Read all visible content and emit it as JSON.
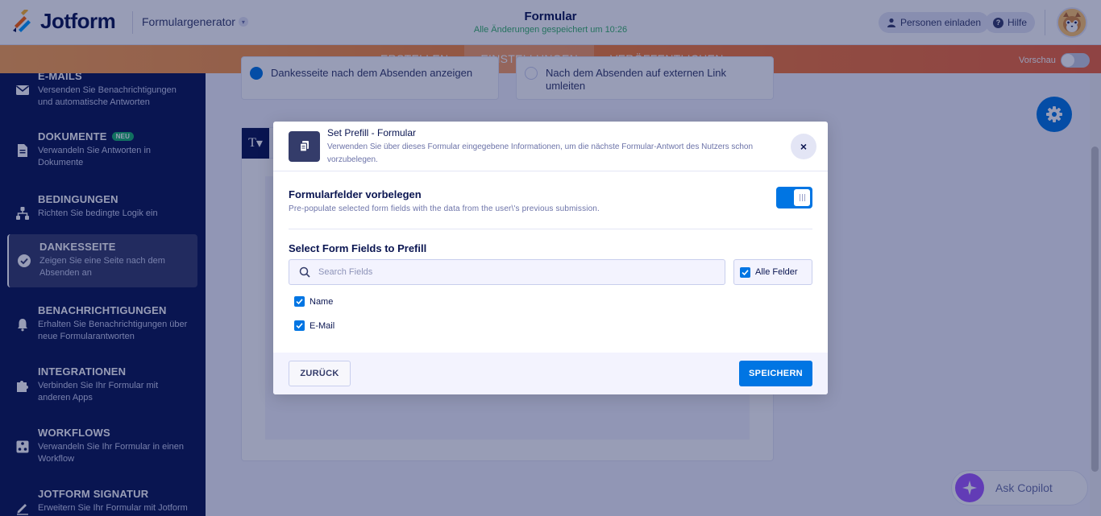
{
  "header": {
    "logo_text": "Jotform",
    "form_generator": "Formulargenerator",
    "form_title": "Formular",
    "save_status": "Alle Änderungen gespeichert um 10:26",
    "invite_label": "Personen einladen",
    "help_label": "Hilfe"
  },
  "nav": {
    "tabs": [
      {
        "label": "ERSTELLEN"
      },
      {
        "label": "EINSTELLUNGEN"
      },
      {
        "label": "VERÖFFENTLICHEN"
      }
    ],
    "active_tab": "EINSTELLUNGEN",
    "preview_label": "Vorschau"
  },
  "sidebar": {
    "items": [
      {
        "title": "E-MAILS",
        "desc": "Versenden Sie Benachrichtigungen und automatische Antworten",
        "icon": "mail-icon"
      },
      {
        "title": "DOKUMENTE",
        "badge": "NEU",
        "desc": "Verwandeln Sie Antworten in Dokumente",
        "icon": "document-icon"
      },
      {
        "title": "BEDINGUNGEN",
        "desc": "Richten Sie bedingte Logik ein",
        "icon": "conditions-icon"
      },
      {
        "title": "DANKESSEITE",
        "desc": "Zeigen Sie eine Seite nach dem Absenden an",
        "icon": "check-circle-icon",
        "active": true
      },
      {
        "title": "BENACHRICHTIGUNGEN",
        "desc": "Erhalten Sie Benachrichtigungen über neue Formularantworten",
        "icon": "bell-icon"
      },
      {
        "title": "INTEGRATIONEN",
        "desc": "Verbinden Sie Ihr Formular mit anderen Apps",
        "icon": "puzzle-icon"
      },
      {
        "title": "WORKFLOWS",
        "desc": "Verwandeln Sie Ihr Formular in einen Workflow",
        "icon": "workflow-icon"
      },
      {
        "title": "JOTFORM SIGNATUR",
        "desc": "Erweitern Sie Ihr Formular mit Jotform",
        "icon": "signature-icon"
      }
    ]
  },
  "main": {
    "option_left": "Dankesseite nach dem Absenden anzeigen",
    "option_right_line1": "Nach dem Absenden auf externen Link",
    "option_right_line2": "umleiten",
    "text_tool": "T"
  },
  "copilot": {
    "label": "Ask Copilot"
  },
  "modal": {
    "title": "Set Prefill - Formular",
    "subtitle": "Verwenden Sie über dieses Formular eingegebene Informationen, um die nächste Formular-Antwort des Nutzers schon vorzubelegen.",
    "close_label": "×",
    "toggle_title": "Formularfelder vorbelegen",
    "toggle_desc": "Pre-populate selected form fields with the data from the user\\'s previous submission.",
    "toggle_on": true,
    "fields_title": "Select Form Fields to Prefill",
    "search_placeholder": "Search Fields",
    "search_value": "",
    "all_fields_label": "Alle Felder",
    "all_fields_checked": true,
    "fields": [
      {
        "label": "Name",
        "checked": true
      },
      {
        "label": "E-Mail",
        "checked": true
      }
    ],
    "back_label": "ZURÜCK",
    "save_label": "SPEICHERN"
  },
  "colors": {
    "primary": "#0075e3",
    "navy": "#0a1551",
    "success": "#3ab56a",
    "nav_gradient_start": "#fca450",
    "nav_gradient_end": "#f0643a"
  }
}
